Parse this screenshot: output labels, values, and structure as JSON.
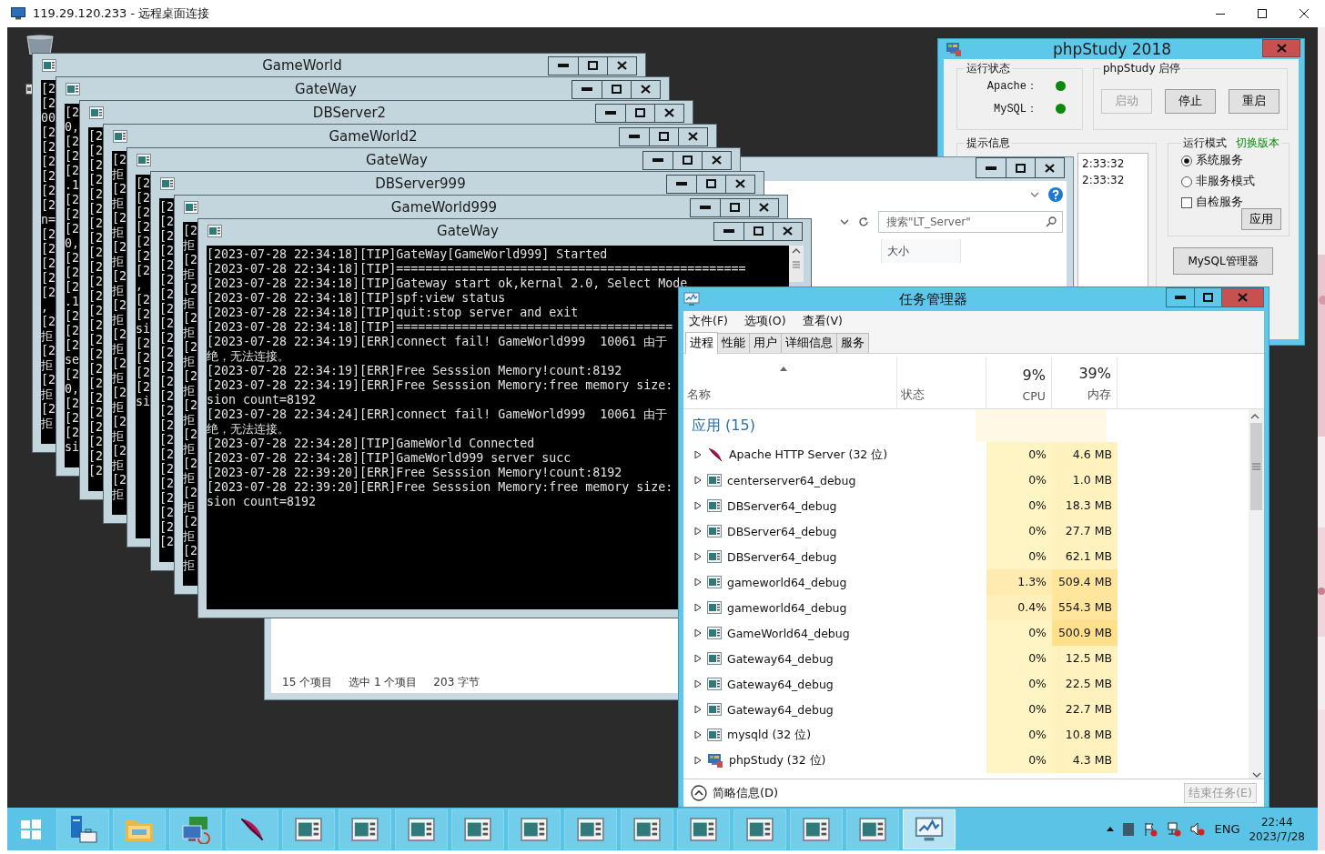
{
  "remote_desktop": {
    "title": "119.29.120.233 - 远程桌面连接"
  },
  "console_windows": [
    {
      "title": "GameWorld",
      "lines": [
        "[2",
        "[2",
        "00",
        "[2",
        "[2",
        "[2",
        "[2",
        "[2",
        "[2",
        "n=",
        "[2",
        "[2",
        "[2",
        "[2",
        "[2",
        ",",
        "[2",
        "拒",
        "[2",
        "拒",
        "[2",
        "拒",
        "[2",
        "拒"
      ]
    },
    {
      "title": "GateWay",
      "lines": [
        "[2",
        "0,",
        "[2",
        "[2",
        "[2",
        ".1",
        "[2",
        "[2",
        "[2",
        "0,",
        "[2",
        "[2",
        "[2",
        ".1",
        "[2",
        "[2",
        "[2",
        "se",
        "[2",
        "0,",
        "[2",
        "[2",
        "[2",
        "si"
      ]
    },
    {
      "title": "DBServer2",
      "lines": [
        "[2",
        "[2",
        "[2",
        "[2",
        "[2",
        "[2",
        "[2",
        "[2",
        "[2",
        "[2",
        "[2",
        "[2",
        "[2",
        "[2",
        "[2",
        "[2",
        "[2",
        "[2",
        "[2",
        "[2",
        "[2",
        "[2",
        "[2",
        "[2"
      ]
    },
    {
      "title": "GameWorld2",
      "lines": [
        "[2",
        "拒",
        "[2",
        "拒",
        "[2",
        "拒",
        "[2",
        "拒",
        "[2",
        "拒",
        "[2",
        "拒",
        "[2",
        "拒",
        "[2",
        "拒",
        "[2",
        "拒",
        "[2",
        "拒",
        "[2",
        "拒",
        "[2",
        "拒"
      ]
    },
    {
      "title": "GateWay",
      "lines": [
        "[2",
        "[2",
        "[2",
        "[2",
        "[2",
        "[2",
        "[2",
        ",",
        "[2",
        "[2",
        "si",
        "[2",
        "[2",
        "[2",
        "[2",
        "si"
      ]
    },
    {
      "title": "DBServer999",
      "lines": [
        "[2",
        "[2",
        "[2",
        "[2",
        "[2",
        "[2",
        "[2",
        "[2",
        "[2",
        "[2",
        "[2",
        "[2",
        "[2",
        "[2",
        "[2",
        "[2",
        "[2",
        "[2",
        "[2",
        "[2",
        "[2",
        "[2",
        "[2",
        "[2"
      ]
    },
    {
      "title": "GameWorld999",
      "lines": [
        "[2",
        "拒",
        "[2",
        "拒",
        "[2",
        "拒",
        "[2",
        "拒",
        "[2",
        "拒",
        "[2",
        "拒",
        "[2",
        "拒",
        "[2",
        "拒",
        "[2",
        "拒",
        "[2",
        "拒",
        "[2",
        "拒",
        "[2",
        "拒"
      ]
    }
  ],
  "active_console": {
    "title": "GateWay",
    "lines": [
      "[2023-07-28 22:34:18][TIP]GateWay[GameWorld999] Started",
      "[2023-07-28 22:34:18][TIP]================================================",
      "[2023-07-28 22:34:18][TIP]Gateway start ok,kernal 2.0, Select Mode",
      "[2023-07-28 22:34:18][TIP]spf:view status",
      "[2023-07-28 22:34:18][TIP]quit:stop server and exit",
      "[2023-07-28 22:34:18][TIP]======================================",
      "[2023-07-28 22:34:19][ERR]connect fail! GameWorld999  10061 由于",
      "绝，无法连接。",
      "[2023-07-28 22:34:19][ERR]Free Sesssion Memory!count:8192",
      "[2023-07-28 22:34:19][ERR]Free Sesssion Memory:free memory size:",
      "sion count=8192",
      "[2023-07-28 22:34:24][ERR]connect fail! GameWorld999  10061 由于",
      "绝，无法连接。",
      "[2023-07-28 22:34:28][TIP]GameWorld Connected",
      "[2023-07-28 22:34:28][TIP]GameWorld999 server succ",
      "[2023-07-28 22:39:20][ERR]Free Sesssion Memory!count:8192",
      "[2023-07-28 22:39:20][ERR]Free Sesssion Memory:free memory size:",
      "sion count=8192"
    ]
  },
  "explorer": {
    "search": {
      "placeholder": "搜索\"LT_Server\""
    },
    "column": "大小",
    "status": [
      "15 个项目",
      "选中 1 个项目",
      "203 字节"
    ]
  },
  "phpstudy": {
    "title": "phpStudy 2018",
    "status_group": "运行状态",
    "services": [
      {
        "name": "Apache：",
        "color": "#0a8a0a"
      },
      {
        "name": "MySQL：",
        "color": "#0a8a0a"
      }
    ],
    "control_group": "phpStudy 启停",
    "buttons": [
      {
        "label": "启动",
        "disabled": true
      },
      {
        "label": "停止",
        "disabled": false
      },
      {
        "label": "重启",
        "disabled": false
      }
    ],
    "log_group": "提示信息",
    "log": [
      "2:33:32",
      "2:33:32"
    ],
    "mode_group": "运行模式",
    "switch_link": "切换版本",
    "modes": [
      {
        "label": "系统服务",
        "selected": true
      },
      {
        "label": "非服务模式",
        "selected": false
      }
    ],
    "self_check": {
      "label": "自检服务",
      "checked": false
    },
    "apply": "应用",
    "mysql_manager": "MySQL管理器"
  },
  "task_manager": {
    "title": "任务管理器",
    "menu": [
      "文件(F)",
      "选项(O)",
      "查看(V)"
    ],
    "tabs": [
      {
        "label": "进程",
        "selected": true
      },
      {
        "label": "性能",
        "selected": false
      },
      {
        "label": "用户",
        "selected": false
      },
      {
        "label": "详细信息",
        "selected": false
      },
      {
        "label": "服务",
        "selected": false
      }
    ],
    "columns": {
      "name": "名称",
      "status": "状态",
      "cpu_total": "9%",
      "cpu": "CPU",
      "mem_total": "39%",
      "mem": "内存"
    },
    "group": "应用 (15)",
    "rows": [
      {
        "kind": "feather",
        "name": "Apache HTTP Server (32 位)",
        "cpu": {
          "value": "0%",
          "color": "#fff4c4"
        },
        "mem": {
          "value": "4.6 MB",
          "color": "#fff2bf"
        }
      },
      {
        "kind": "console",
        "name": "centerserver64_debug",
        "cpu": {
          "value": "0%",
          "color": "#fff4c4"
        },
        "mem": {
          "value": "1.0 MB",
          "color": "#fff2bf"
        }
      },
      {
        "kind": "console",
        "name": "DBServer64_debug",
        "cpu": {
          "value": "0%",
          "color": "#fff4c4"
        },
        "mem": {
          "value": "18.3 MB",
          "color": "#fff2bf"
        }
      },
      {
        "kind": "console",
        "name": "DBServer64_debug",
        "cpu": {
          "value": "0%",
          "color": "#fff4c4"
        },
        "mem": {
          "value": "27.7 MB",
          "color": "#fff2bf"
        }
      },
      {
        "kind": "console",
        "name": "DBServer64_debug",
        "cpu": {
          "value": "0%",
          "color": "#fff4c4"
        },
        "mem": {
          "value": "62.1 MB",
          "color": "#fff2bf"
        }
      },
      {
        "kind": "console",
        "name": "gameworld64_debug",
        "cpu": {
          "value": "1.3%",
          "color": "#ffeab0"
        },
        "mem": {
          "value": "509.4 MB",
          "color": "#ffe69c"
        }
      },
      {
        "kind": "console",
        "name": "gameworld64_debug",
        "cpu": {
          "value": "0.4%",
          "color": "#ffefbb"
        },
        "mem": {
          "value": "554.3 MB",
          "color": "#ffe69c"
        }
      },
      {
        "kind": "console",
        "name": "GameWorld64_debug",
        "cpu": {
          "value": "0%",
          "color": "#fff4c4"
        },
        "mem": {
          "value": "500.9 MB",
          "color": "#ffe18c"
        }
      },
      {
        "kind": "console",
        "name": "Gateway64_debug",
        "cpu": {
          "value": "0%",
          "color": "#fff4c4"
        },
        "mem": {
          "value": "12.5 MB",
          "color": "#fff2bf"
        }
      },
      {
        "kind": "console",
        "name": "Gateway64_debug",
        "cpu": {
          "value": "0%",
          "color": "#fff4c4"
        },
        "mem": {
          "value": "22.5 MB",
          "color": "#fff2bf"
        }
      },
      {
        "kind": "console",
        "name": "Gateway64_debug",
        "cpu": {
          "value": "0%",
          "color": "#fff4c4"
        },
        "mem": {
          "value": "22.7 MB",
          "color": "#fff2bf"
        }
      },
      {
        "kind": "console",
        "name": "mysqld (32 位)",
        "cpu": {
          "value": "0%",
          "color": "#fff4c4"
        },
        "mem": {
          "value": "10.8 MB",
          "color": "#fff2bf"
        }
      },
      {
        "kind": "phpstudy",
        "name": "phpStudy (32 位)",
        "cpu": {
          "value": "0%",
          "color": "#fff4c4"
        },
        "mem": {
          "value": "4.3 MB",
          "color": "#fff2bf"
        }
      }
    ],
    "details": "简略信息(D)",
    "end_task": {
      "label": "结束任务(E)",
      "disabled": true
    }
  },
  "taskbar": {
    "items": [
      {
        "kind": "start",
        "selected": false
      },
      {
        "kind": "server-manager",
        "selected": false
      },
      {
        "kind": "folder",
        "selected": false
      },
      {
        "kind": "remote",
        "selected": false
      },
      {
        "kind": "feather",
        "selected": false
      },
      {
        "kind": "console",
        "selected": false
      },
      {
        "kind": "console",
        "selected": false
      },
      {
        "kind": "console",
        "selected": false
      },
      {
        "kind": "console",
        "selected": false
      },
      {
        "kind": "console",
        "selected": false
      },
      {
        "kind": "console",
        "selected": false
      },
      {
        "kind": "console",
        "selected": false
      },
      {
        "kind": "console",
        "selected": false
      },
      {
        "kind": "console",
        "selected": false
      },
      {
        "kind": "console",
        "selected": false
      },
      {
        "kind": "console",
        "selected": false
      },
      {
        "kind": "task-manager",
        "selected": true
      }
    ],
    "language": "ENG",
    "time": "22:44",
    "date": "2023/7/28"
  }
}
